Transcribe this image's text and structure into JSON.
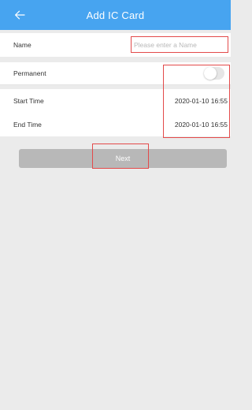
{
  "header": {
    "title": "Add IC Card",
    "back_icon": "arrow-left-icon",
    "background": "#47a4f0"
  },
  "form": {
    "name": {
      "label": "Name",
      "value": "",
      "placeholder": "Please enter a Name"
    },
    "permanent": {
      "label": "Permanent",
      "enabled": false
    },
    "start_time": {
      "label": "Start Time",
      "value": "2020-01-10 16:55"
    },
    "end_time": {
      "label": "End Time",
      "value": "2020-01-10 16:55"
    }
  },
  "next_button": {
    "label": "Next",
    "state": "disabled"
  },
  "highlight_color": "#e34a4a"
}
